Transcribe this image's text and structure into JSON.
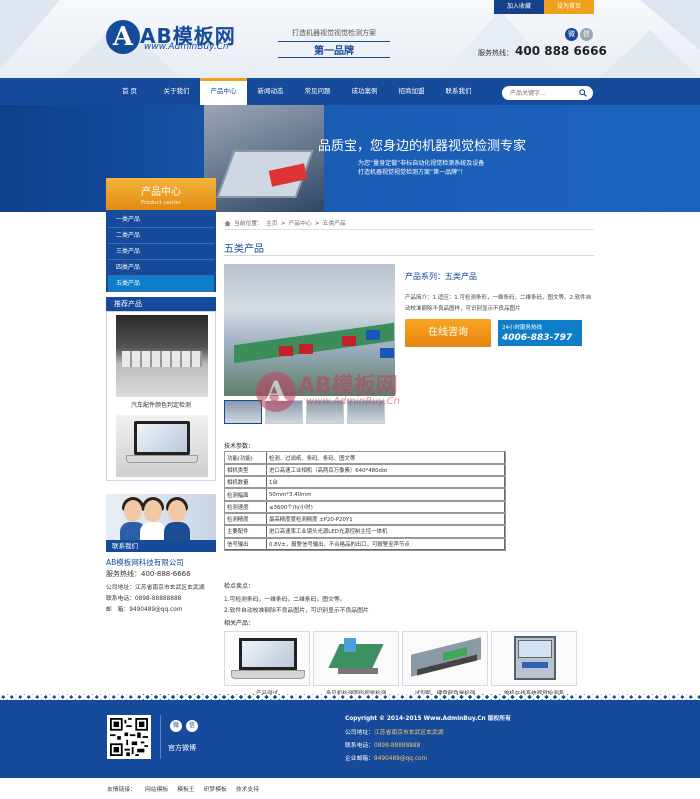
{
  "top_links": {
    "favorite": "加入收藏",
    "homepage": "设为首页"
  },
  "logo": {
    "mark": "A",
    "title": "AB模板网",
    "url": "www.AdminBuy.Cn"
  },
  "slogan": {
    "line1": "打造机器视觉视觉检测方案",
    "line2": "第一品牌"
  },
  "social": {
    "weibo": "微",
    "wechat": "信"
  },
  "hotline": {
    "label": "服务热线：",
    "number": "400 888 6666"
  },
  "nav": {
    "items": [
      "首 页",
      "关于我们",
      "产品中心",
      "新闻动态",
      "常见问题",
      "成功案例",
      "招商加盟",
      "联系我们"
    ],
    "active_index": 2
  },
  "search": {
    "placeholder": "产品关键字..."
  },
  "banner": {
    "title": "品质宝，您身边的机器视觉检测专家",
    "sub1": "为您“量身定做”非标自动化视觉检测系统及设备",
    "sub2": "打造机器视觉视觉检测方案“第一品牌”！"
  },
  "sidebar": {
    "title": "产品中心",
    "subtitle": "Product center",
    "menu": [
      "一类产品",
      "二类产品",
      "三类产品",
      "四类产品",
      "五类产品"
    ],
    "active_index": 4,
    "recommend_title": "推荐产品",
    "recommend_items": [
      {
        "caption": "汽车配件颜色判定检测"
      }
    ],
    "contact_title": "联系我们",
    "company": "AB模板网科技有限公司",
    "phone_label": "服务热线：",
    "phone": "400-888-6666",
    "address": "公司地址：江苏省南京市玄武区玄武湖",
    "contact": "联系电话：0898-88888888",
    "email": "邮　箱：9490489@qq.com"
  },
  "main": {
    "breadcrumb": {
      "prefix": "当前位置：",
      "home": "主页",
      "level1": "产品中心",
      "level2": "五类产品",
      "sep": ">"
    },
    "title": "五类产品",
    "series": "产品系列：五类产品",
    "series_desc": "产品简介：1.适应：1.可检测条形，一维条码，二维条码，图文等。2.软件自动校准剔除不良品图样，可识别显示不良品图片",
    "consult_button": "在线咨询",
    "hotline_label": "24小时服务热线",
    "hotline_number": "4006-883-797",
    "params_label": "技术参数：",
    "params": [
      [
        "功能(功能)",
        "检测、过滤纸、条码、条码、图文等"
      ],
      [
        "相机类型",
        "进口高速工业相机（高两百万像素）640*480dot"
      ],
      [
        "相机数量",
        "1台"
      ],
      [
        "检测幅面",
        "50mm*3.40mm"
      ],
      [
        "检测速度",
        "≤3600个/h(小时)"
      ],
      [
        "检测精度",
        "最高精度度检测精度 ±P20-P20Y1"
      ],
      [
        "主要配件",
        "进口高速率工业镜头光源LED光源控制主控一体机"
      ],
      [
        "信号输出",
        "0.8V±，报警信号输出，不合格品的出口，可报警至声节点"
      ]
    ],
    "features_label": "检点卖点：",
    "features": [
      "1.可检测条码，一维条码，二维条码，图文等。",
      "2.软件自动校准剔除不良品图片，可识别显示不良品图片"
    ],
    "related_label": "相关产品：",
    "related": [
      {
        "caption": "产品测试"
      },
      {
        "caption": "多贝机检测图形视觉检测"
      },
      {
        "caption": "试剂瓶，硬盘颜色是检测"
      },
      {
        "caption": "单机在线系统视觉检测系"
      }
    ]
  },
  "watermark": {
    "mark": "A",
    "title": "AB模板网",
    "url": "www.AdminBuy.Cn"
  },
  "footer": {
    "official": "官方微博",
    "copyright": "Copyright © 2014-2015 Www.AdminBuy.Cn 版权所有",
    "address_label": "公司地址：",
    "address": "江苏省南京市玄武区玄武湖",
    "phone_label": "联系电话：",
    "phone": "0898-88888888",
    "email_label": "企业邮箱：",
    "email": "9490489@qq.com",
    "links": [
      "友情链接：",
      "网站模板",
      "模板王",
      "织梦模板",
      "技术支持"
    ]
  },
  "colors": {
    "brand_blue": "#164a9a",
    "accent_orange": "#f0a01c",
    "cyan": "#0e7ec8"
  }
}
